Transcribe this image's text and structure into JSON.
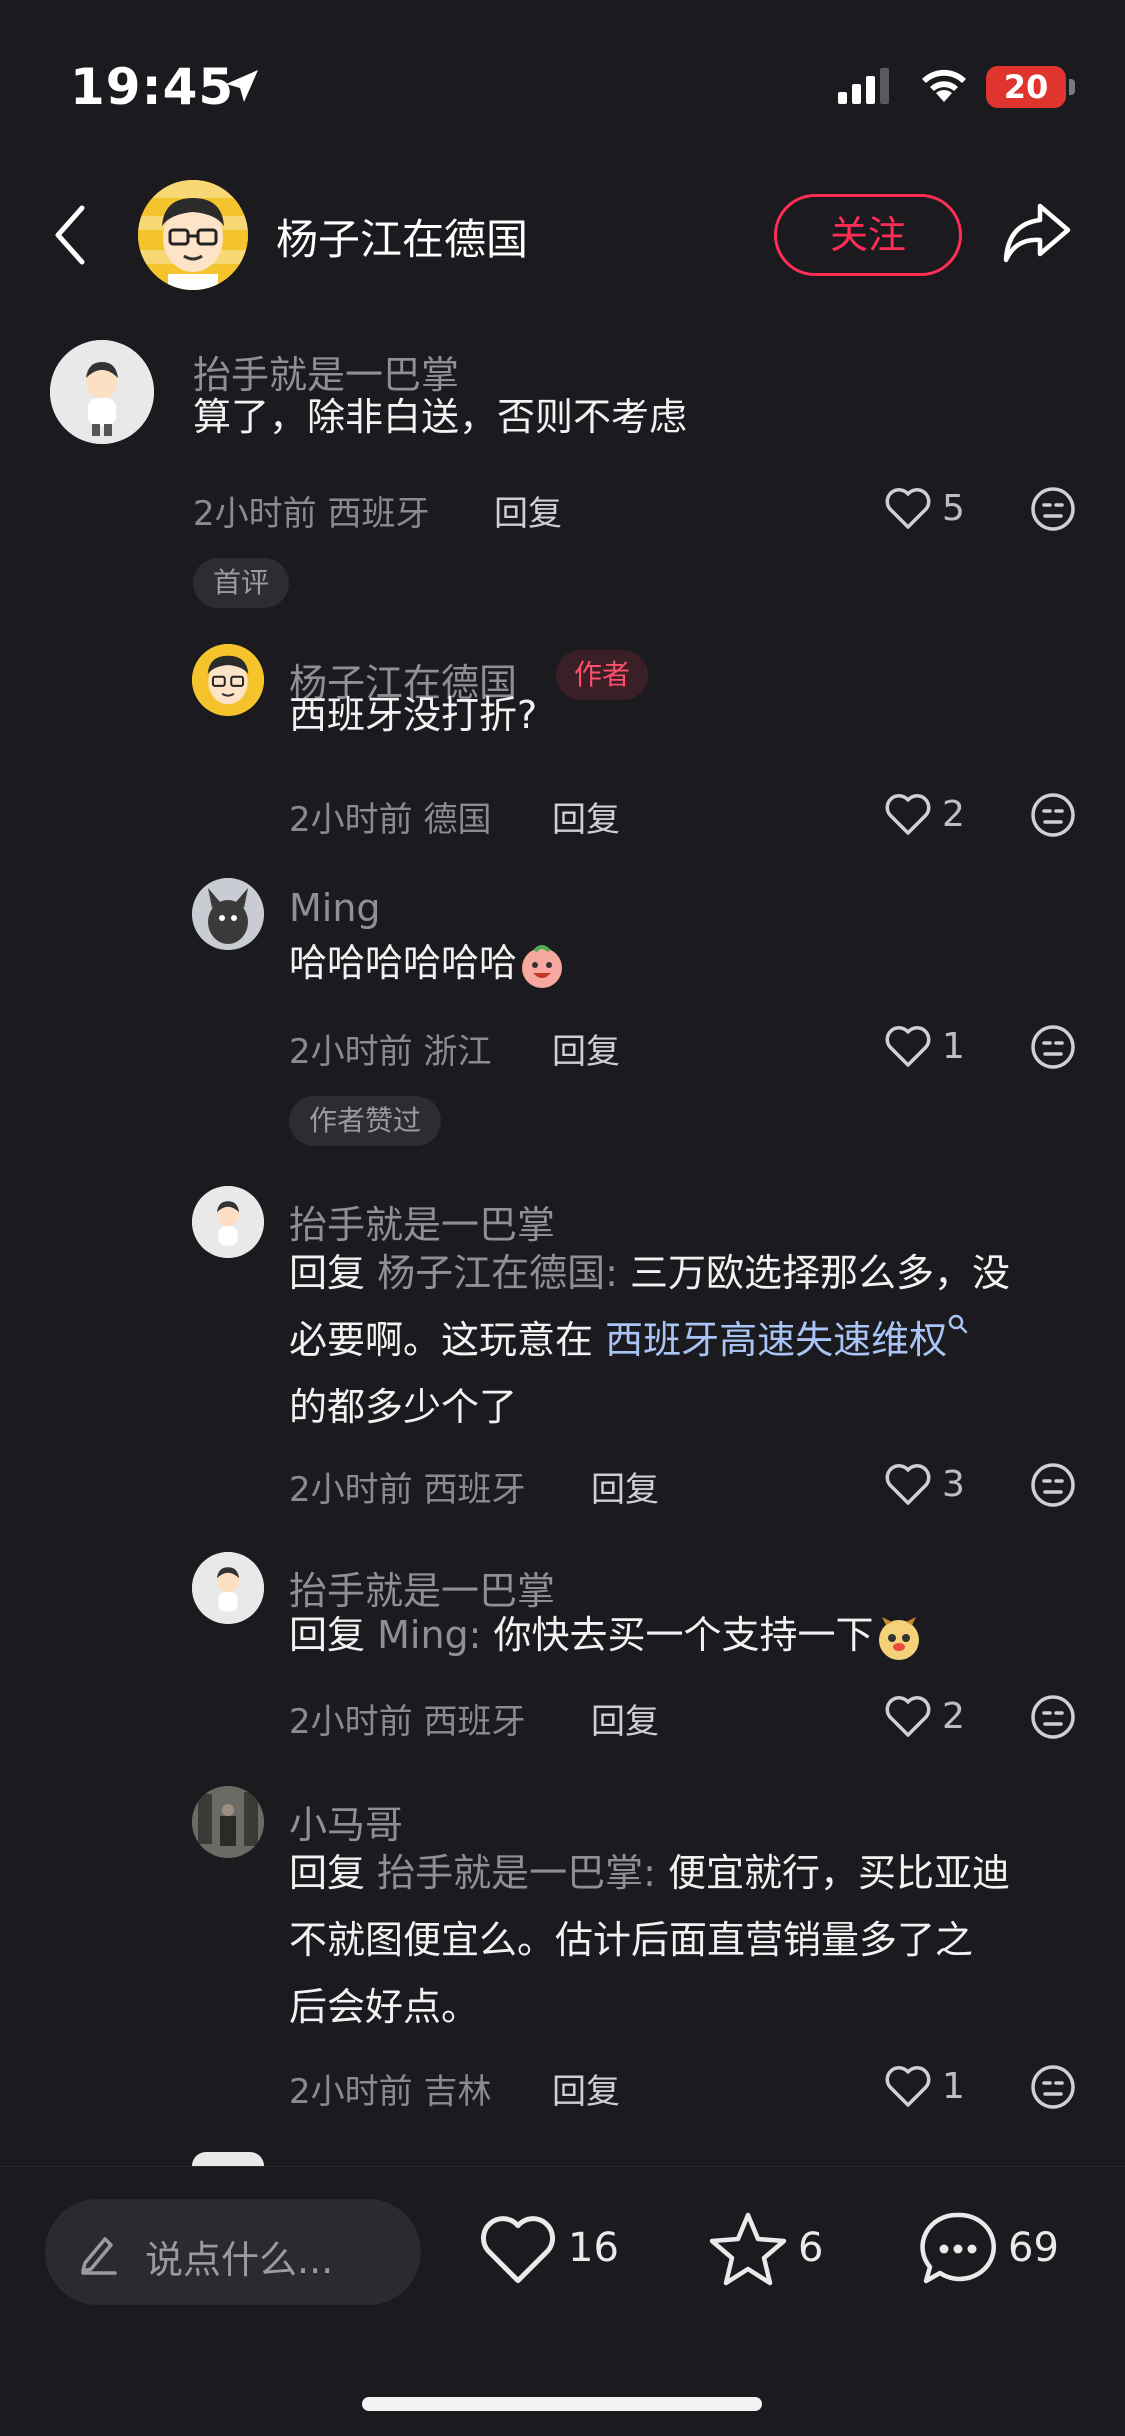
{
  "status_bar": {
    "time": "19:45",
    "battery_level": "20",
    "battery_color": "#e0352f"
  },
  "header": {
    "back": "back",
    "author_name": "杨子江在德国",
    "follow_label": "关注",
    "share": "share"
  },
  "comments": [
    {
      "user": "抬手就是一巴掌",
      "text": "算了，除非白送，否则不考虑",
      "time": "2小时前",
      "location": "西班牙",
      "reply_label": "回复",
      "likes": "5",
      "tag": "首评"
    },
    {
      "user": "杨子江在德国",
      "badge": "作者",
      "text": "西班牙没打折?",
      "time": "2小时前",
      "location": "德国",
      "reply_label": "回复",
      "likes": "2"
    },
    {
      "user": "Ming",
      "text": "哈哈哈哈哈哈",
      "time": "2小时前",
      "location": "浙江",
      "reply_label": "回复",
      "likes": "1",
      "tag": "作者赞过"
    },
    {
      "user": "抬手就是一巴掌",
      "prefix": "回复",
      "mention": "杨子江在德国:",
      "line1": " 三万欧选择那么多，没",
      "line2_pre": "必要啊。这玩意在 ",
      "link": "西班牙高速失速维权",
      "line3": "的都多少个了",
      "time": "2小时前",
      "location": "西班牙",
      "reply_label": "回复",
      "likes": "3"
    },
    {
      "user": "抬手就是一巴掌",
      "prefix": "回复",
      "mention": "Ming:",
      "line1": " 你快去买一个支持一下",
      "time": "2小时前",
      "location": "西班牙",
      "reply_label": "回复",
      "likes": "2"
    },
    {
      "user": "小马哥",
      "prefix": "回复",
      "mention": "抬手就是一巴掌:",
      "line1": " 便宜就行，买比亚迪",
      "line2": "不就图便宜么。估计后面直营销量多了之",
      "line3": "后会好点。",
      "time": "2小时前",
      "location": "吉林",
      "reply_label": "回复",
      "likes": "1"
    }
  ],
  "bottom_bar": {
    "input_placeholder": "说点什么...",
    "like_count": "16",
    "star_count": "6",
    "comment_count": "69"
  }
}
